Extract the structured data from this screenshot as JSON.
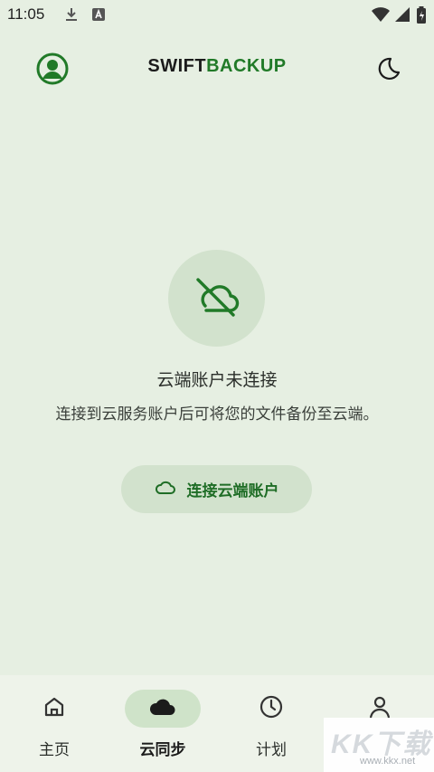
{
  "status_bar": {
    "time": "11:05",
    "icons": [
      "download-icon",
      "text-a-icon",
      "wifi-icon",
      "signal-icon",
      "battery-icon"
    ]
  },
  "header": {
    "title_part1": "SWIFT",
    "title_part2": "BACKUP",
    "title_color_1": "#1b1b1b",
    "title_color_2": "#217a28",
    "left_icon": "account-icon",
    "right_icon": "moon-icon"
  },
  "empty_state": {
    "icon": "cloud-off-icon",
    "title": "云端账户未连接",
    "description": "连接到云服务账户后可将您的文件备份至云端。",
    "button_label": "连接云端账户",
    "button_icon": "cloud-icon"
  },
  "bottom_nav": {
    "items": [
      {
        "label": "主页",
        "icon": "home-icon",
        "active": false
      },
      {
        "label": "云同步",
        "icon": "cloud-icon",
        "active": true
      },
      {
        "label": "计划",
        "icon": "clock-icon",
        "active": false
      },
      {
        "label": "",
        "icon": "person-icon",
        "active": false
      }
    ]
  },
  "watermark": {
    "text": "KK下载",
    "url": "www.kkx.net"
  },
  "colors": {
    "background": "#e6efe2",
    "accent": "#217a28",
    "accent_container": "#d2e2cd"
  }
}
